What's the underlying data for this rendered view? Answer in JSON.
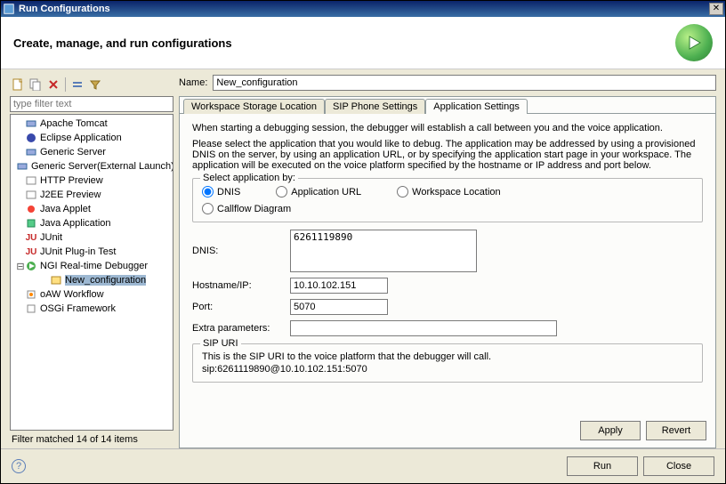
{
  "window": {
    "title": "Run Configurations"
  },
  "header": {
    "heading": "Create, manage, and run configurations"
  },
  "filter": {
    "placeholder": "type filter text"
  },
  "tree": {
    "items": [
      {
        "label": "Apache Tomcat",
        "icon": "server"
      },
      {
        "label": "Eclipse Application",
        "icon": "eclipse"
      },
      {
        "label": "Generic Server",
        "icon": "server"
      },
      {
        "label": "Generic Server(External Launch)",
        "icon": "server"
      },
      {
        "label": "HTTP Preview",
        "icon": "http"
      },
      {
        "label": "J2EE Preview",
        "icon": "http"
      },
      {
        "label": "Java Applet",
        "icon": "applet"
      },
      {
        "label": "Java Application",
        "icon": "java"
      },
      {
        "label": "JUnit",
        "icon": "junit"
      },
      {
        "label": "JUnit Plug-in Test",
        "icon": "junit"
      },
      {
        "label": "NGI Real-time Debugger",
        "icon": "debugger",
        "expanded": true,
        "children": [
          {
            "label": "New_configuration",
            "icon": "config",
            "selected": true
          }
        ]
      },
      {
        "label": "oAW Workflow",
        "icon": "workflow"
      },
      {
        "label": "OSGi Framework",
        "icon": "osgi"
      }
    ]
  },
  "status": {
    "text": "Filter matched 14 of 14 items"
  },
  "form": {
    "name_label": "Name:",
    "name_value": "New_configuration",
    "tabs": [
      {
        "label": "Workspace Storage Location"
      },
      {
        "label": "SIP Phone Settings"
      },
      {
        "label": "Application Settings",
        "active": true
      }
    ],
    "desc1": "When starting a debugging session, the debugger will establish a call between you and the voice application.",
    "desc2": "Please select the application that you would like to debug.  The application may be addressed by using a provisioned DNIS on the server, by using an application URL, or by specifying the application start page in your workspace.  The application will be executed on the voice platform specified by the hostname or IP address and port below.",
    "select_group": {
      "title": "Select application by:",
      "options": {
        "dnis": "DNIS",
        "url": "Application URL",
        "workspace": "Workspace Location",
        "callflow": "Callflow Diagram"
      },
      "selected": "dnis"
    },
    "fields": {
      "dnis_label": "DNIS:",
      "dnis_value": "6261119890",
      "hostname_label": "Hostname/IP:",
      "hostname_value": "10.10.102.151",
      "port_label": "Port:",
      "port_value": "5070",
      "extra_label": "Extra parameters:",
      "extra_value": ""
    },
    "sipuri": {
      "title": "SIP URI",
      "desc": "This is the SIP URI to the voice platform that the debugger will call.",
      "value": "sip:6261119890@10.10.102.151:5070"
    },
    "buttons": {
      "apply": "Apply",
      "revert": "Revert"
    }
  },
  "footer": {
    "run": "Run",
    "close": "Close"
  }
}
